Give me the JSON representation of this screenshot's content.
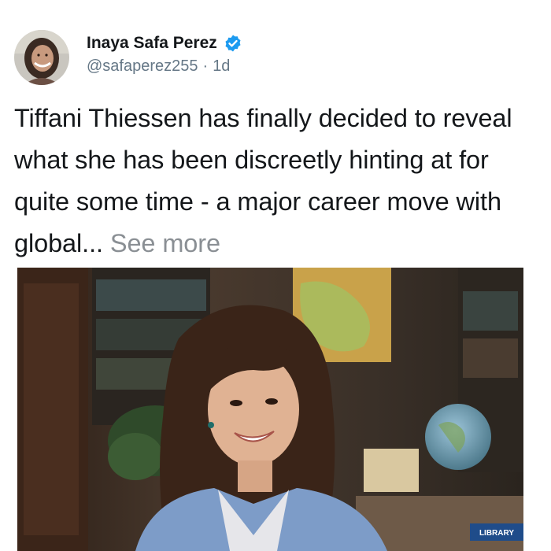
{
  "author": {
    "display_name": "Inaya Safa Perez",
    "handle": "@safaperez255",
    "separator": "·",
    "time": "1d",
    "verified": true,
    "avatar_icon": "profile-photo"
  },
  "tweet": {
    "text": "Tiffani Thiessen has finally decided to reveal what she has been discreetly hinting at for quite some time - a major career move with global...",
    "see_more_label": "See more"
  },
  "media": {
    "sign_text": "LIBRARY"
  },
  "colors": {
    "verified": "#1d9bf0",
    "secondary_text": "#657786",
    "see_more": "#8a8f94"
  }
}
